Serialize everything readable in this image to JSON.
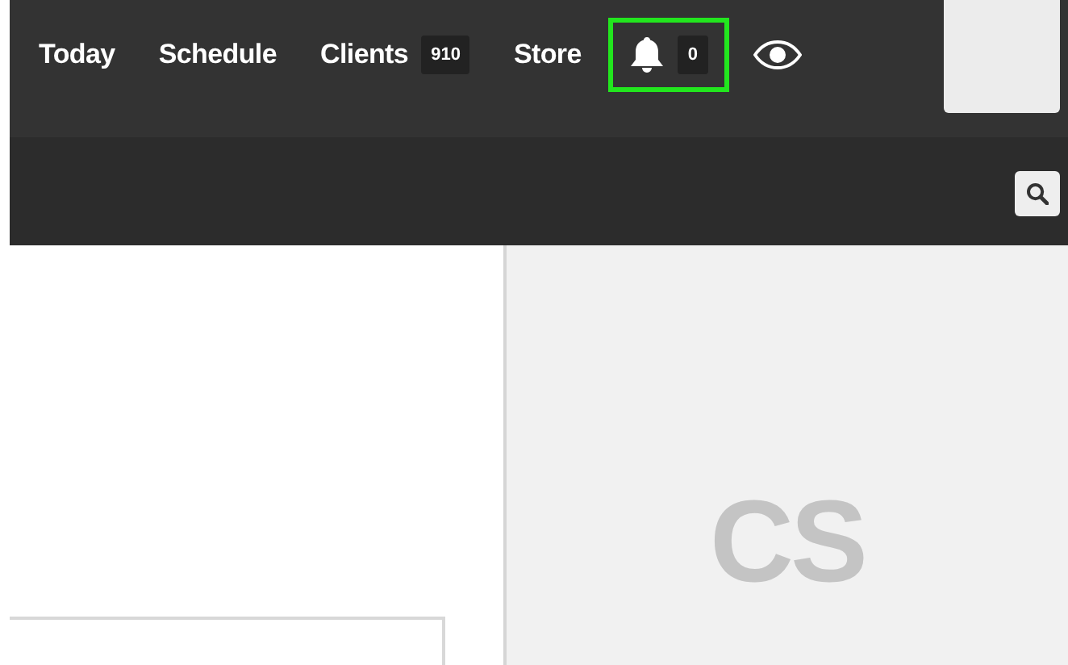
{
  "nav": [
    {
      "kind": "link",
      "label": "Today"
    },
    {
      "kind": "link",
      "label": "Schedule"
    },
    {
      "kind": "link",
      "label": "Clients",
      "badge": "910"
    },
    {
      "kind": "link",
      "label": "Store"
    },
    {
      "kind": "bell",
      "badge": "0",
      "highlighted": true
    },
    {
      "kind": "eye"
    }
  ],
  "profile": {
    "initials": "CS"
  }
}
